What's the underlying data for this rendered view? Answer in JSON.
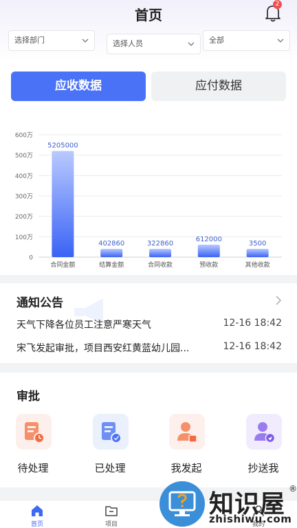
{
  "header": {
    "title": "首页",
    "badge_count": "2"
  },
  "filters": {
    "department": "选择部门",
    "person": "选择人员",
    "scope": "全部"
  },
  "tabs": [
    {
      "label": "应收数据",
      "active": true
    },
    {
      "label": "应付数据",
      "active": false
    }
  ],
  "chart_data": {
    "type": "bar",
    "categories": [
      "合同金额",
      "结算金额",
      "合同收款",
      "预收款",
      "其他收款"
    ],
    "values": [
      5205000,
      402860,
      322860,
      612000,
      3500
    ],
    "value_labels": [
      "5205000",
      "402860",
      "322860",
      "612000",
      "3500"
    ],
    "y_ticks": [
      "0",
      "100万",
      "200万",
      "300万",
      "400万",
      "500万",
      "600万"
    ],
    "ylim": [
      0,
      6000000
    ],
    "grid": true,
    "colors": {
      "bar_top": "#b9caff",
      "bar_bottom": "#3a63f5",
      "label": "#3d5fc9"
    }
  },
  "notice": {
    "title": "通知公告",
    "items": [
      {
        "text": "天气下降各位员工注意严寒天气",
        "date": "12-16 18:42"
      },
      {
        "text": "宋飞发起审批，项目西安红黄蓝幼儿园...",
        "date": "12-16 18:42"
      }
    ]
  },
  "approval": {
    "title": "审批",
    "items": [
      {
        "label": "待处理",
        "icon": "pending-doc-icon"
      },
      {
        "label": "已处理",
        "icon": "processed-doc-icon"
      },
      {
        "label": "我发起",
        "icon": "initiated-user-icon"
      },
      {
        "label": "抄送我",
        "icon": "cc-user-icon"
      }
    ]
  },
  "tabbar": [
    {
      "label": "首页",
      "icon": "home-icon",
      "active": true
    },
    {
      "label": "项目",
      "icon": "folder-icon",
      "active": false
    },
    {
      "label": "我的",
      "icon": "profile-icon",
      "active": false
    }
  ],
  "watermark": {
    "name": "知识屋",
    "domain": "zhishiwu.com",
    "reg": "®"
  },
  "colors": {
    "accent": "#4a72f7",
    "badge": "#f04f4f"
  }
}
